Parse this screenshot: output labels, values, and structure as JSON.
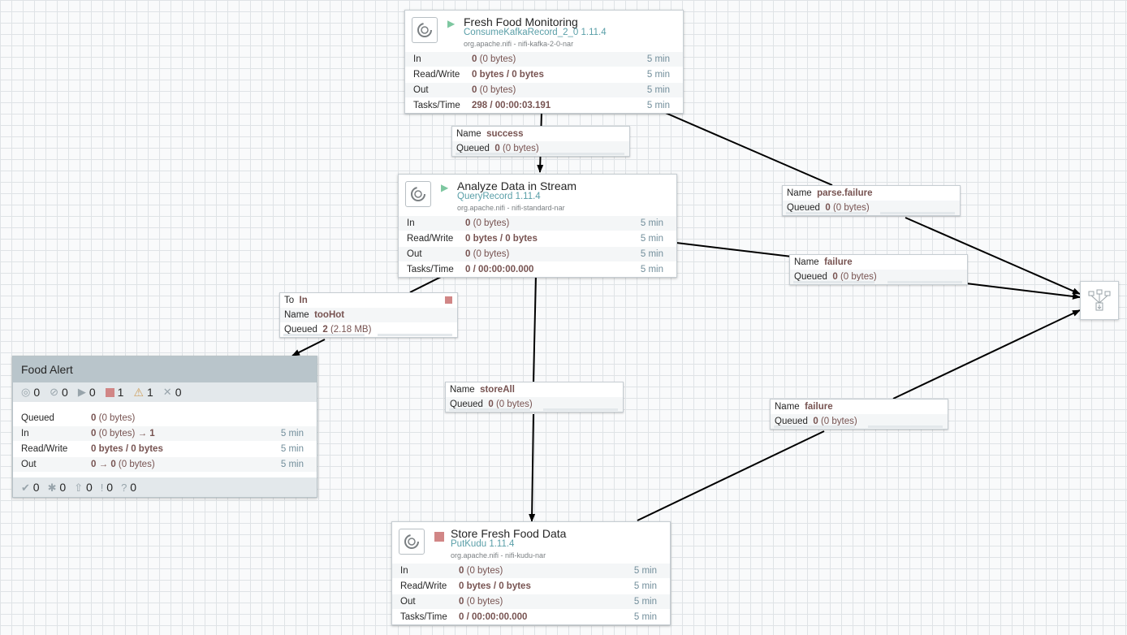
{
  "processors": {
    "fresh": {
      "name": "Fresh Food Monitoring",
      "type": "ConsumeKafkaRecord_2_0 1.11.4",
      "bundle": "org.apache.nifi - nifi-kafka-2-0-nar",
      "state": "running",
      "in_v": "0",
      "in_d": "(0 bytes)",
      "rw": "0 bytes / 0 bytes",
      "out_v": "0",
      "out_d": "(0 bytes)",
      "tasks": "298 / 00:00:03.191"
    },
    "analyze": {
      "name": "Analyze Data in Stream",
      "type": "QueryRecord 1.11.4",
      "bundle": "org.apache.nifi - nifi-standard-nar",
      "state": "running",
      "in_v": "0",
      "in_d": "(0 bytes)",
      "rw": "0 bytes / 0 bytes",
      "out_v": "0",
      "out_d": "(0 bytes)",
      "tasks": "0 / 00:00:00.000"
    },
    "store": {
      "name": "Store Fresh Food Data",
      "type": "PutKudu 1.11.4",
      "bundle": "org.apache.nifi - nifi-kudu-nar",
      "state": "stopped",
      "in_v": "0",
      "in_d": "(0 bytes)",
      "rw": "0 bytes / 0 bytes",
      "out_v": "0",
      "out_d": "(0 bytes)",
      "tasks": "0 / 00:00:00.000"
    }
  },
  "labels": {
    "in": "In",
    "rw": "Read/Write",
    "out": "Out",
    "tasks": "Tasks/Time",
    "time": "5 min",
    "name": "Name",
    "queued": "Queued",
    "to": "To"
  },
  "connections": {
    "success": {
      "name": "success",
      "q": "0",
      "qd": "(0 bytes)"
    },
    "parse_failure": {
      "name": "parse.failure",
      "q": "0",
      "qd": "(0 bytes)"
    },
    "failure1": {
      "name": "failure",
      "q": "0",
      "qd": "(0 bytes)"
    },
    "toohot": {
      "to": "In",
      "name": "tooHot",
      "q": "2",
      "qd": "(2.18 MB)",
      "queue_fill": 0.0
    },
    "storeall": {
      "name": "storeAll",
      "q": "0",
      "qd": "(0 bytes)"
    },
    "failure2": {
      "name": "failure",
      "q": "0",
      "qd": "(0 bytes)"
    }
  },
  "group": {
    "name": "Food Alert",
    "transmitting": "0",
    "not_transmitting": "0",
    "running": "0",
    "stopped": "1",
    "invalid": "1",
    "disabled": "0",
    "queued_v": "0",
    "queued_d": "(0 bytes)",
    "in_v": "0",
    "in_d": "(0 bytes)",
    "in_ports": "1",
    "rw": "0 bytes / 0 bytes",
    "out_v": "0",
    "out_ports": "0",
    "out_d": "(0 bytes)",
    "up_to_date": "0",
    "locally_modified": "0",
    "stale": "0",
    "sync_failure": "0",
    "unknown": "0",
    "arrow": "→"
  },
  "colors": {
    "running": "#7dc7a0",
    "stopped": "#d18686",
    "value": "#775351",
    "type": "#5a9fa8"
  }
}
